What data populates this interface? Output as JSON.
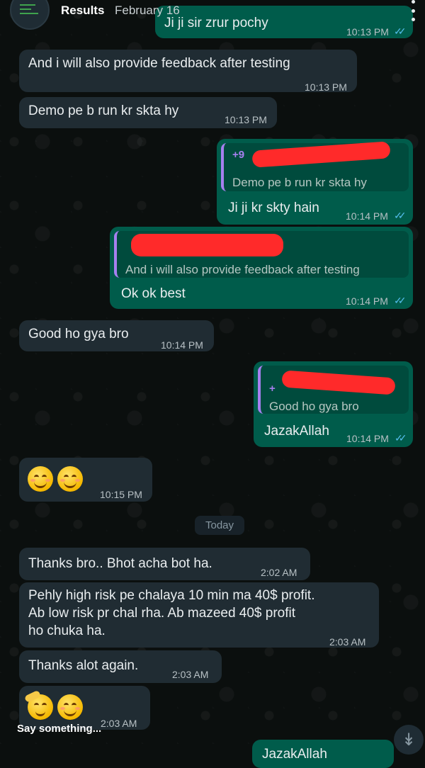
{
  "header": {
    "title": "Results",
    "date": "February 16"
  },
  "messages": [
    {
      "id": "m0",
      "direction": "out",
      "text": "Ji ji sir zrur pochy",
      "time": "10:13 PM"
    },
    {
      "id": "m1",
      "direction": "in",
      "text": "And i will also provide feedback after testing",
      "time": "10:13 PM"
    },
    {
      "id": "m2",
      "direction": "in",
      "text": "Demo pe b run kr skta hy",
      "time": "10:13 PM"
    },
    {
      "id": "m3",
      "direction": "out",
      "quote_author": "+9",
      "quote_text": "Demo pe b run kr skta hy",
      "text": "Ji ji kr skty hain",
      "time": "10:14 PM"
    },
    {
      "id": "m4",
      "direction": "out",
      "quote_text": "And i will also provide feedback after testing",
      "text": "Ok ok best",
      "time": "10:14 PM"
    },
    {
      "id": "m5",
      "direction": "in",
      "text": "Good ho gya bro",
      "time": "10:14 PM"
    },
    {
      "id": "m6",
      "direction": "out",
      "quote_author": "+",
      "quote_text": "Good ho gya bro",
      "text": "JazakAllah",
      "time": "10:14 PM"
    },
    {
      "id": "m7",
      "direction": "in",
      "text": "😊😊",
      "time": "10:15 PM"
    },
    {
      "id": "m8",
      "direction": "in",
      "text": "Thanks bro.. Bhot acha bot ha.",
      "time": "2:02 AM"
    },
    {
      "id": "m9",
      "direction": "in",
      "lines": [
        "Pehly high risk pe chalaya 10 min ma 40$ profit.",
        "Ab low risk pr chal rha. Ab mazeed 40$ profit",
        "ho chuka ha."
      ],
      "time": "2:03 AM"
    },
    {
      "id": "m10",
      "direction": "in",
      "text": "Thanks alot again.",
      "time": "2:03 AM"
    },
    {
      "id": "m11",
      "direction": "in",
      "text": "🫡😊",
      "time": "2:03 AM"
    },
    {
      "id": "m12",
      "direction": "out",
      "text": "JazakAllah"
    }
  ],
  "date_separator": "Today",
  "composer": {
    "placeholder": "Say something..."
  },
  "icons": {
    "read_receipt": "double-check-icon",
    "menu": "more-vertical-icon",
    "scroll": "chevron-down-double-icon"
  },
  "colors": {
    "incoming_bubble": "#202c33",
    "outgoing_bubble": "#005c4b",
    "read_ticks": "#53bdeb",
    "quote_bar": "#a680f0",
    "redaction": "#ff2a2a"
  }
}
